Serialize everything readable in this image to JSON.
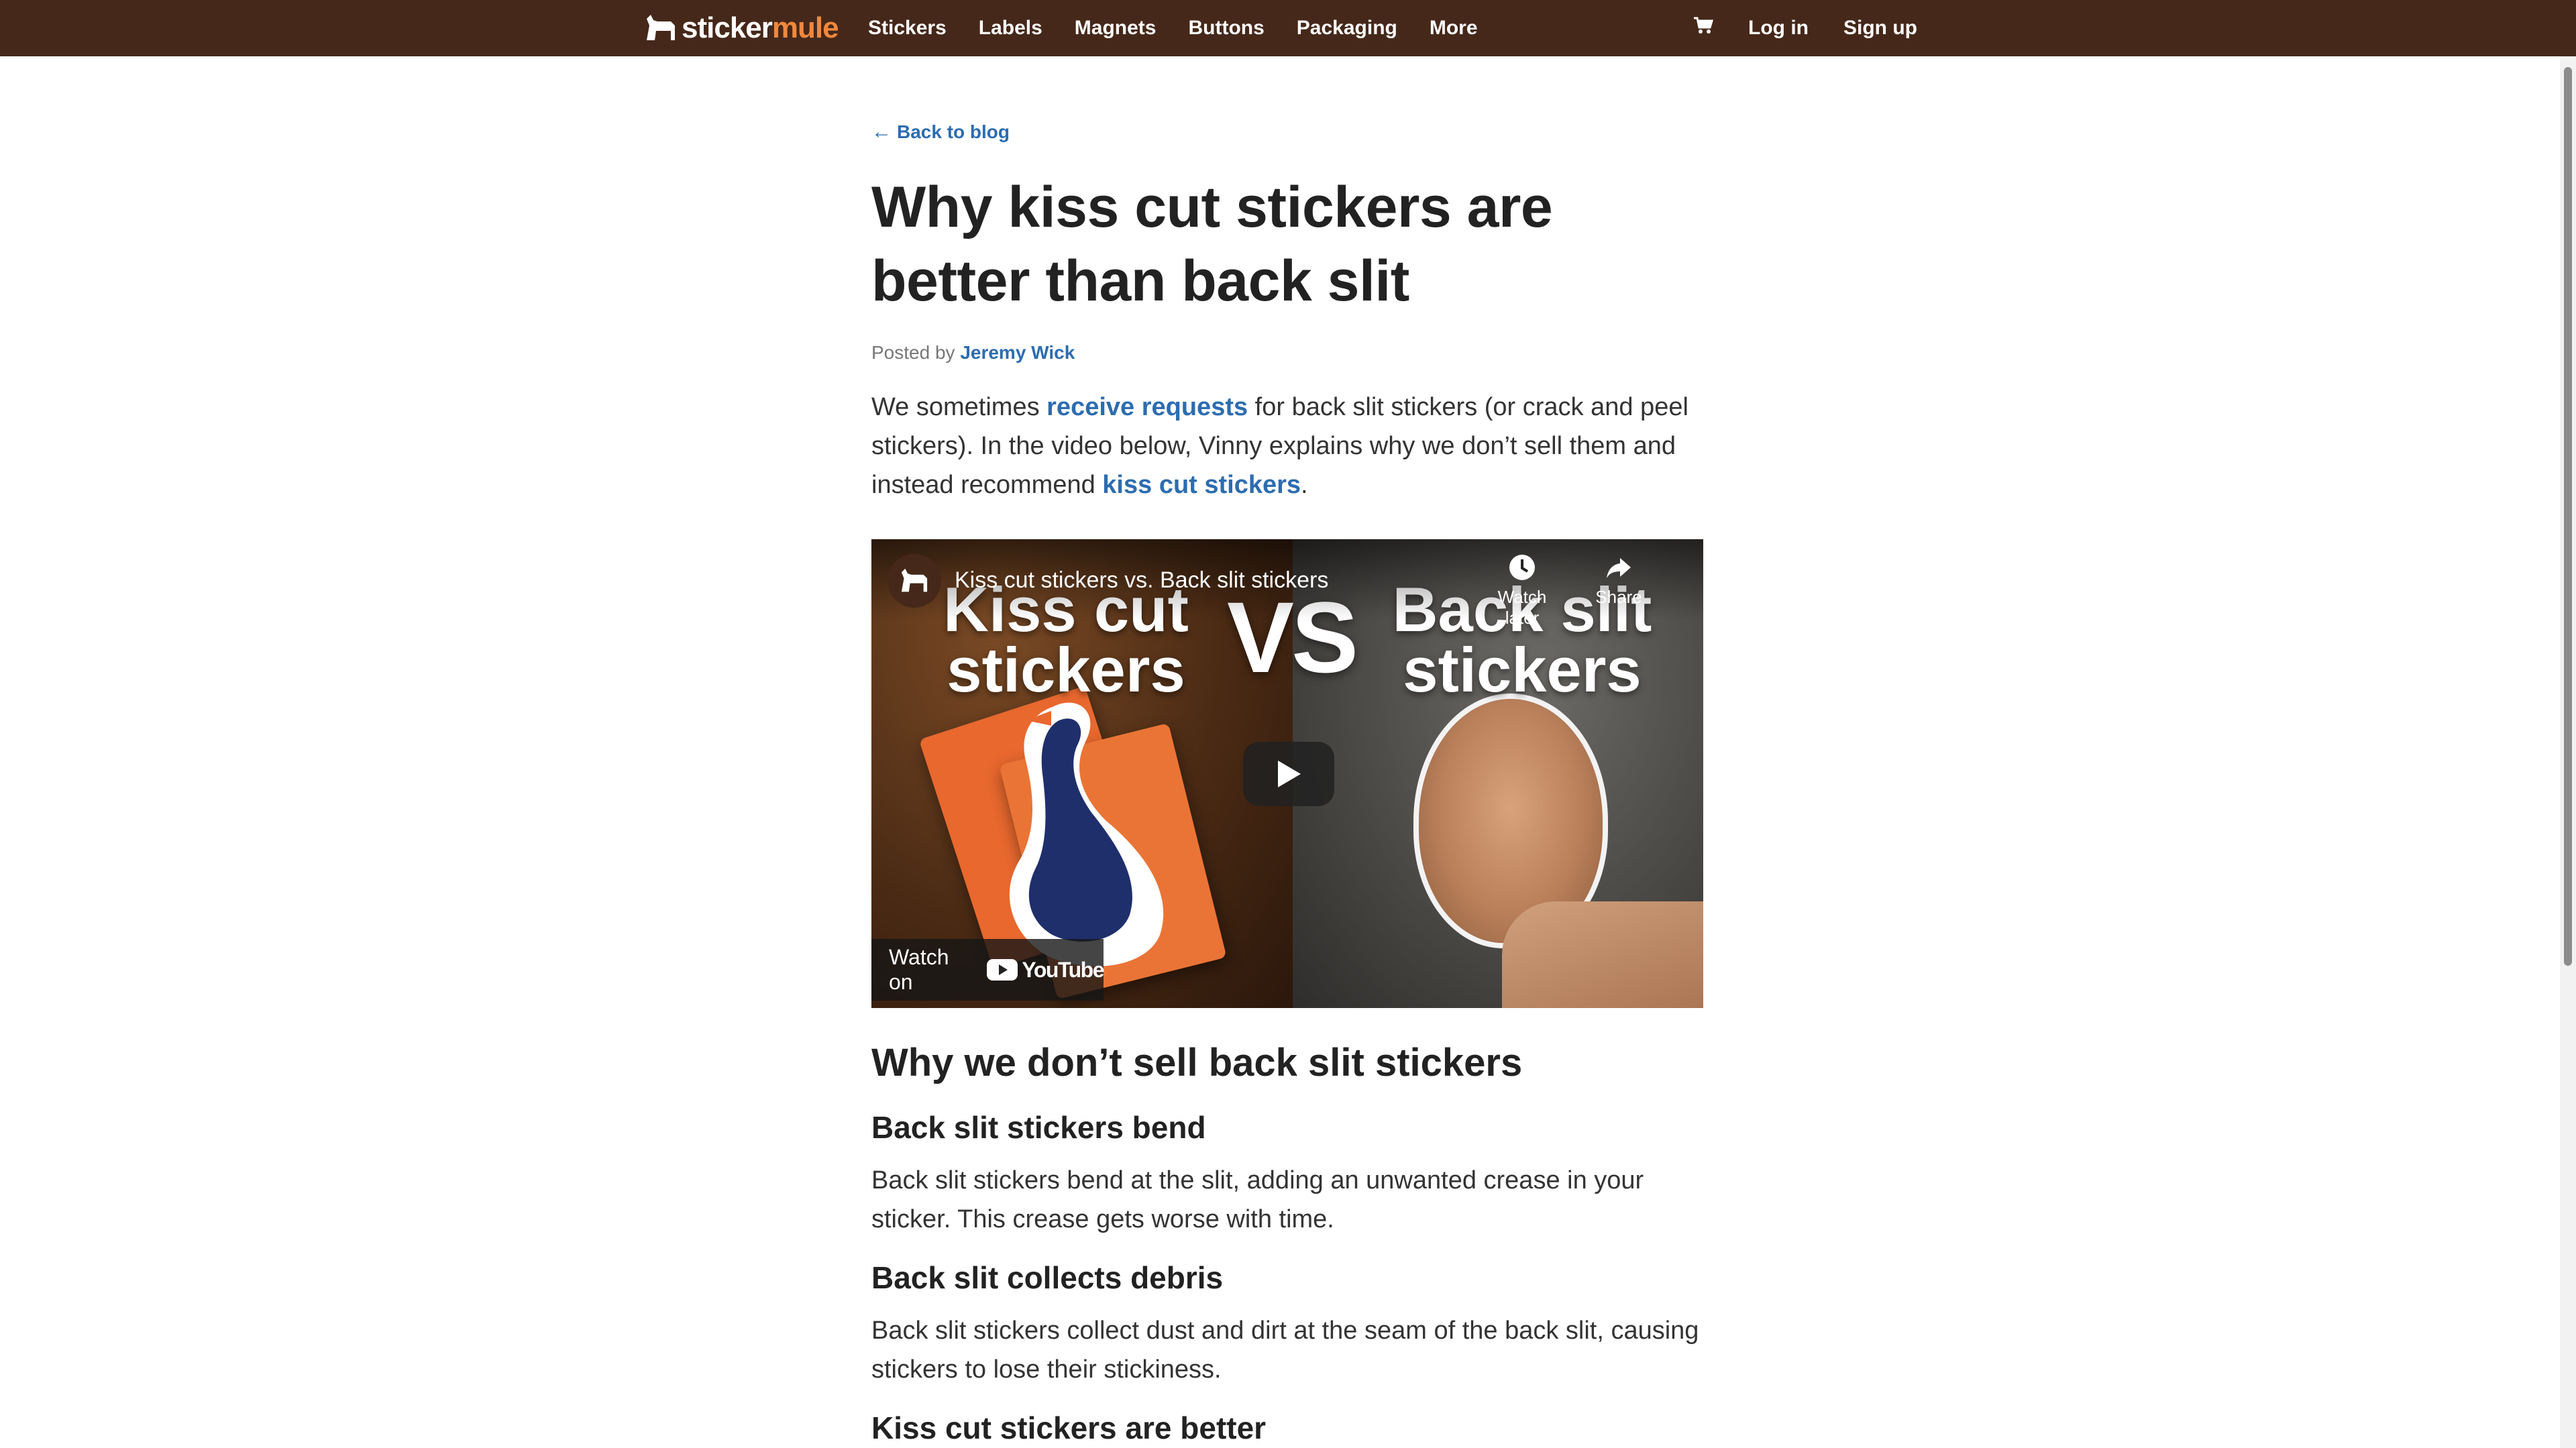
{
  "header": {
    "logo_part1": "sticker",
    "logo_part2": "mule",
    "nav": [
      "Stickers",
      "Labels",
      "Magnets",
      "Buttons",
      "Packaging",
      "More"
    ],
    "login": "Log in",
    "signup": "Sign up",
    "bg_color": "#45281a",
    "accent_color": "#f0883e"
  },
  "article": {
    "back_link": "Back to blog",
    "back_arrow": "←",
    "title": "Why kiss cut stickers are better than back slit",
    "byline_prefix": "Posted by",
    "author": "Jeremy Wick",
    "intro": {
      "t1": "We sometimes ",
      "link1": "receive requests",
      "t2": " for back slit stickers (or crack and peel stickers). In the video below, Vinny explains why we don’t sell them and instead recommend ",
      "link2": "kiss cut stickers",
      "t3": "."
    }
  },
  "video": {
    "title": "Kiss cut stickers vs. Back slit stickers",
    "thumb_left_line1": "Kiss cut",
    "thumb_left_line2": "stickers",
    "thumb_vs": "VS",
    "thumb_right_line1": "Back slit",
    "thumb_right_line2": "stickers",
    "watch_later": "Watch later",
    "share": "Share",
    "watch_on": "Watch on",
    "youtube": "YouTube"
  },
  "sections": {
    "h2": "Why we don’t sell back slit stickers",
    "s1_title": "Back slit stickers bend",
    "s1_text": "Back slit stickers bend at the slit, adding an unwanted crease in your sticker. This crease gets worse with time.",
    "s2_title": "Back slit collects debris",
    "s2_text": "Back slit stickers collect dust and dirt at the seam of the back slit, causing stickers to lose their stickiness.",
    "s3_title": "Kiss cut stickers are better"
  },
  "colors": {
    "link": "#2d6cb0",
    "text": "#222222"
  }
}
